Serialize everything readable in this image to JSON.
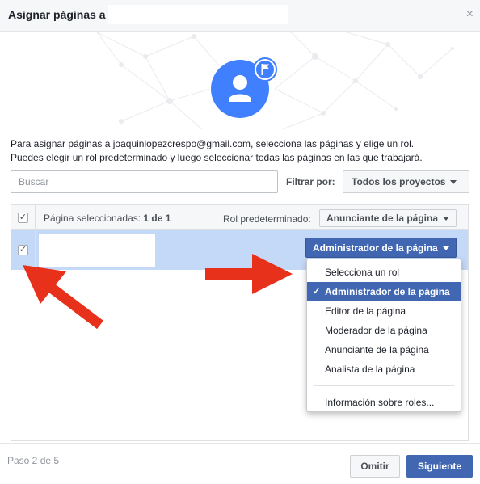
{
  "dialog": {
    "title": "Asignar páginas a",
    "close_symbol": "×"
  },
  "description": {
    "line1": "Para asignar páginas a joaquinlopezcrespo@gmail.com, selecciona las páginas y elige un rol.",
    "line2": "Puedes elegir un rol predeterminado y luego seleccionar todas las páginas en las que trabajará."
  },
  "search": {
    "placeholder": "Buscar",
    "value": ""
  },
  "filter": {
    "label": "Filtrar por:",
    "selected": "Todos los proyectos"
  },
  "table": {
    "selected_prefix": "Página seleccionadas: ",
    "selected_count": "1 de 1",
    "default_role_label": "Rol predeterminado:",
    "default_role_value": "Anunciante de la página",
    "header_checked": true,
    "rows": [
      {
        "checked": true,
        "role": "Administrador de la página"
      }
    ]
  },
  "role_menu": {
    "items": [
      "Selecciona un rol",
      "Administrador de la página",
      "Editor de la página",
      "Moderador de la página",
      "Anunciante de la página",
      "Analista de la página"
    ],
    "selected_index": 1,
    "check_symbol": "✓",
    "info_link": "Información sobre roles..."
  },
  "footer": {
    "step": "Paso 2 de 5",
    "skip": "Omitir",
    "next": "Siguiente"
  },
  "colors": {
    "accent": "#4267b2",
    "avatar": "#4080ff",
    "selected_row": "#c4d9f7",
    "annotation_arrow": "#e8311b"
  }
}
